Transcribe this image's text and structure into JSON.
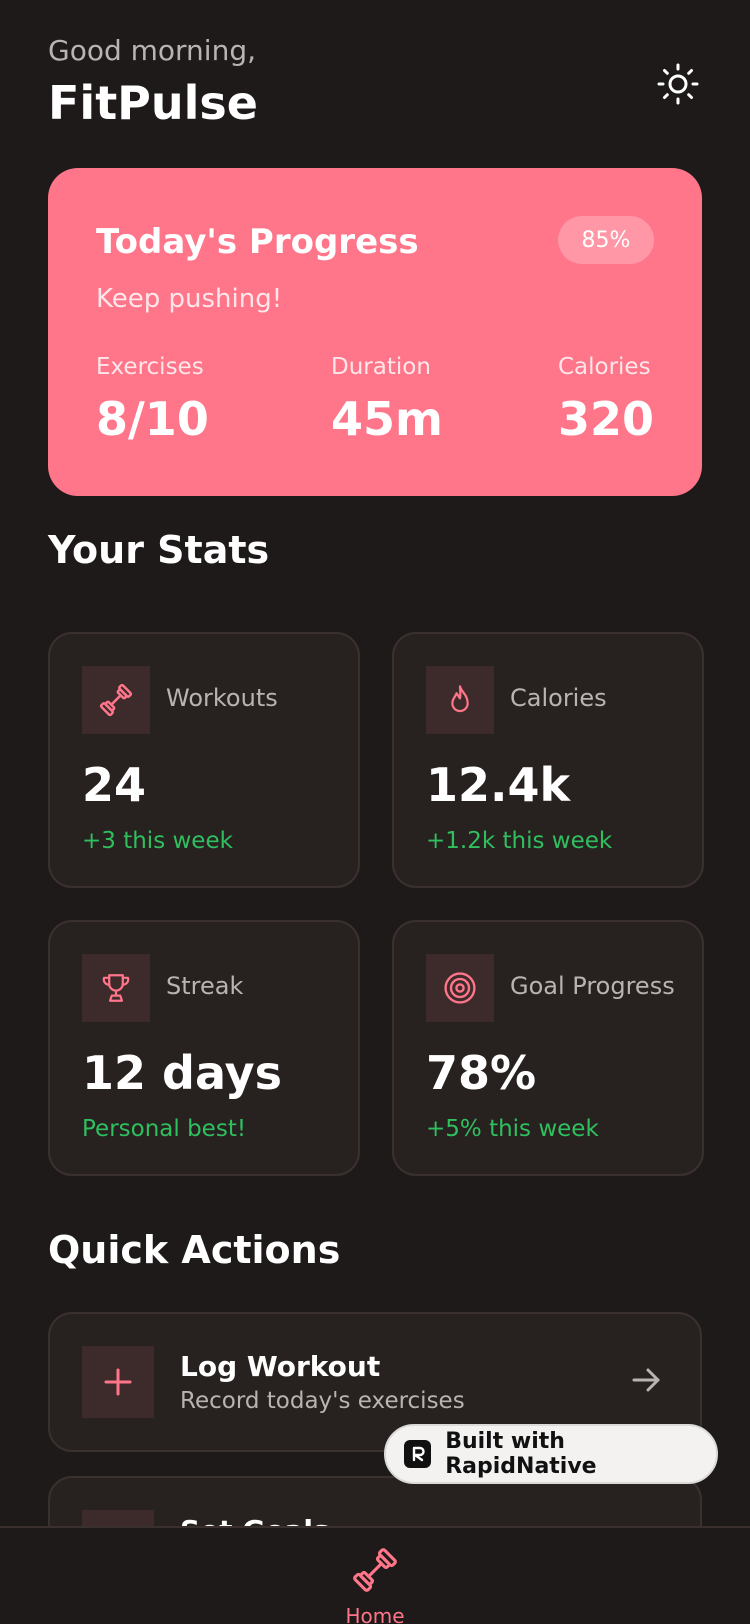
{
  "header": {
    "greeting": "Good morning,",
    "title": "FitPulse",
    "theme_toggle_icon": "sun-icon"
  },
  "progress": {
    "title": "Today's Progress",
    "subtitle": "Keep pushing!",
    "badge": "85%",
    "metrics": [
      {
        "label": "Exercises",
        "value": "8/10"
      },
      {
        "label": "Duration",
        "value": "45m"
      },
      {
        "label": "Calories",
        "value": "320"
      }
    ]
  },
  "stats": {
    "title": "Your Stats",
    "cards": [
      {
        "icon": "dumbbell-icon",
        "label": "Workouts",
        "value": "24",
        "delta": "+3 this week"
      },
      {
        "icon": "flame-icon",
        "label": "Calories",
        "value": "12.4k",
        "delta": "+1.2k this week"
      },
      {
        "icon": "trophy-icon",
        "label": "Streak",
        "value": "12 days",
        "delta": "Personal best!"
      },
      {
        "icon": "target-icon",
        "label": "Goal Progress",
        "value": "78%",
        "delta": "+5% this week"
      }
    ]
  },
  "quick_actions": {
    "title": "Quick Actions",
    "items": [
      {
        "icon": "plus-icon",
        "title": "Log Workout",
        "subtitle": "Record today's exercises"
      },
      {
        "icon": "target-icon",
        "title": "Set Goals",
        "subtitle": ""
      }
    ]
  },
  "badge": {
    "label": "Built with RapidNative"
  },
  "nav": {
    "home_label": "Home"
  },
  "colors": {
    "background": "#1e1a19",
    "accent": "#ff7589",
    "card": "#272220",
    "positive": "#2fbf5f"
  }
}
